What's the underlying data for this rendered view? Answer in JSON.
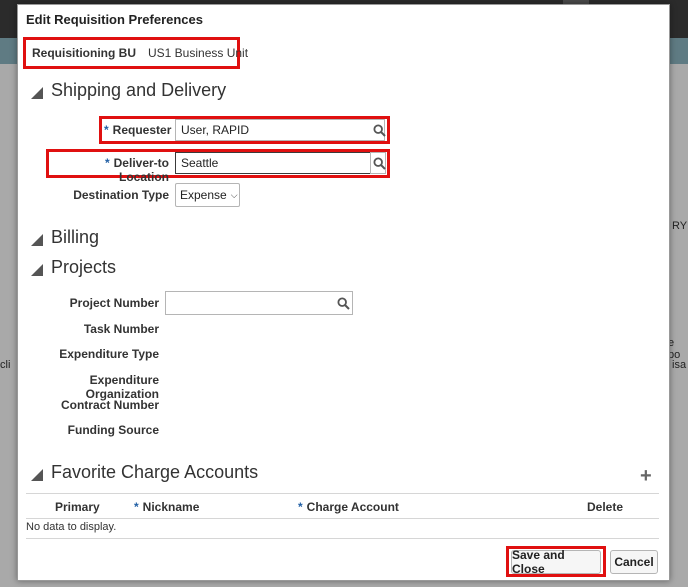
{
  "dialog": {
    "title": "Edit Requisition Preferences"
  },
  "requisitioning_bu": {
    "label": "Requisitioning BU",
    "value": "US1 Business Unit"
  },
  "shipping": {
    "heading": "Shipping and Delivery",
    "requester_label": "Requester",
    "requester_value": "User, RAPID",
    "deliver_to_label": "Deliver-to Location",
    "deliver_to_value": "Seattle",
    "destination_type_label": "Destination Type",
    "destination_type_value": "Expense"
  },
  "billing": {
    "heading": "Billing"
  },
  "projects": {
    "heading": "Projects",
    "project_number_label": "Project Number",
    "project_number_value": "",
    "task_number_label": "Task Number",
    "expenditure_type_label": "Expenditure Type",
    "expenditure_org_label": "Expenditure Organization",
    "contract_number_label": "Contract Number",
    "funding_source_label": "Funding Source"
  },
  "favorites": {
    "heading": "Favorite Charge Accounts",
    "columns": {
      "primary": "Primary",
      "nickname": "Nickname",
      "charge_account": "Charge Account",
      "delete": "Delete"
    },
    "empty_text": "No data to display."
  },
  "buttons": {
    "save_close": "Save and Close",
    "cancel": "Cancel"
  },
  "background": {
    "left_fragment": "cli",
    "right_fragment_1": "RY",
    "right_fragment_2": "e po",
    "right_fragment_3": "isa"
  },
  "icons": {
    "search": "search-icon",
    "add": "plus-icon",
    "collapse": "triangle-icon"
  },
  "colors": {
    "highlight": "#e01010",
    "required": "#2360a5"
  }
}
